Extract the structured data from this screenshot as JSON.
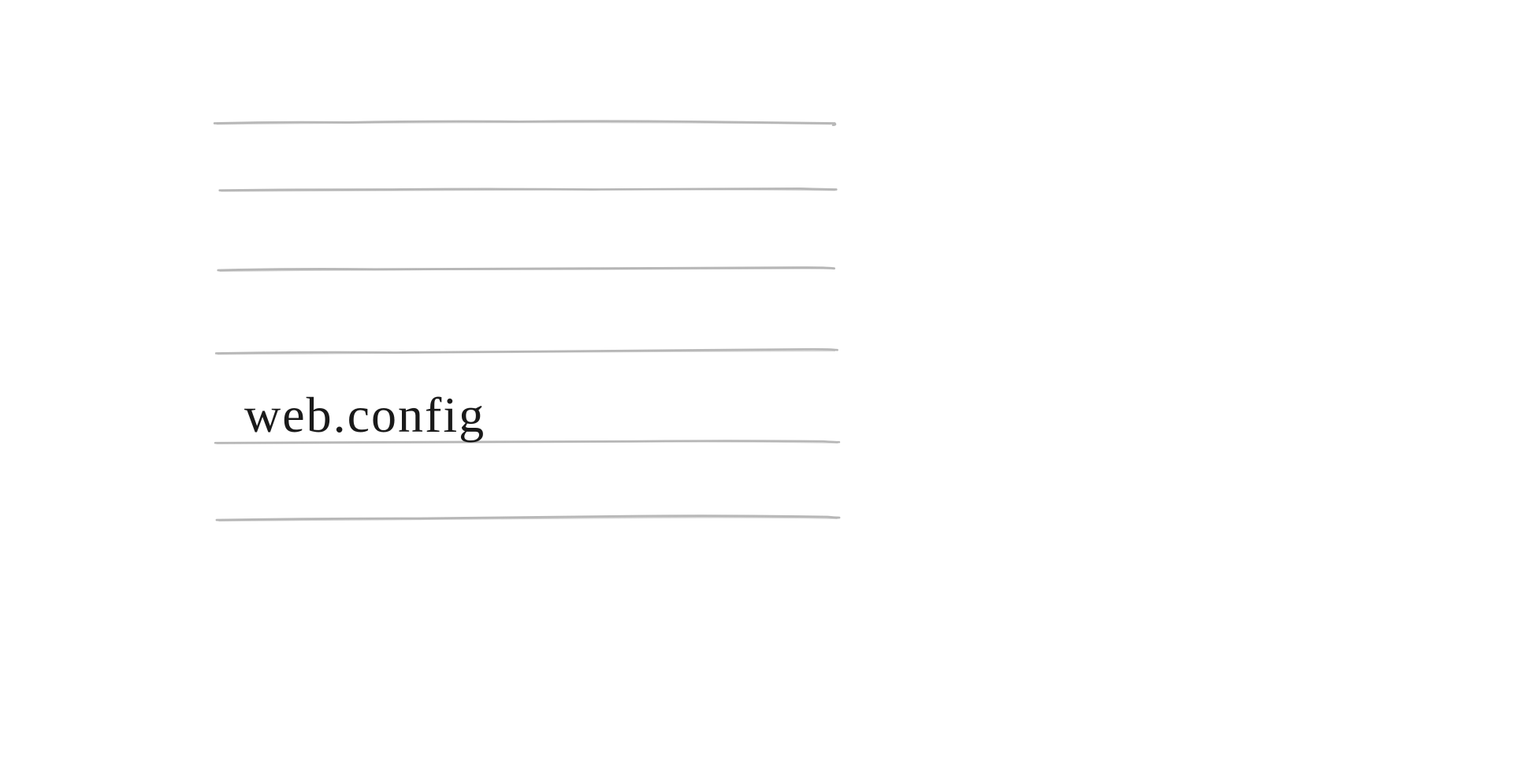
{
  "content": {
    "text": "web.config"
  }
}
